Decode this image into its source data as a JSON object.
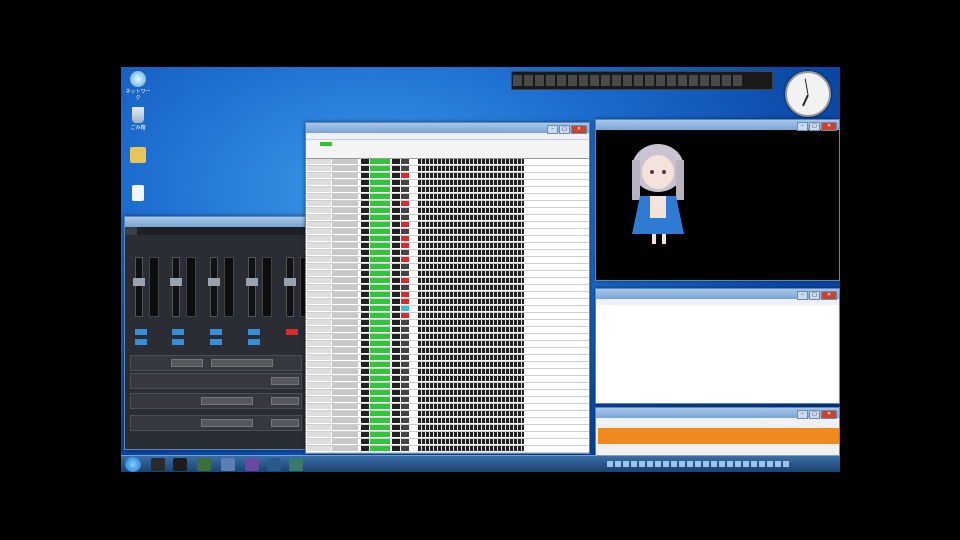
{
  "desktop": {
    "icons": [
      {
        "name": "network-icon",
        "label": "ネットワーク"
      },
      {
        "name": "recycle-bin-icon",
        "label": "ごみ箱"
      },
      {
        "name": "folder-icon",
        "label": ""
      },
      {
        "name": "file-icon",
        "label": ""
      }
    ]
  },
  "mixer": {
    "title": "",
    "tab": "",
    "channels": [
      "",
      "",
      "",
      "",
      ""
    ]
  },
  "list_window": {
    "title": ""
  },
  "video": {
    "title": "",
    "lyrics": [
      "",
      "",
      "",
      "",
      "",
      "",
      ""
    ]
  },
  "log_window": {
    "title": "",
    "line": ""
  },
  "orange_window": {
    "title": "",
    "strip_text": ""
  },
  "taskbar": {
    "time": "",
    "date": ""
  },
  "colors": {
    "accent_green": "#2fc63a",
    "accent_red": "#d92b2b",
    "accent_orange": "#ef8a1c",
    "titlebar_blue": "#7aa4d4"
  }
}
